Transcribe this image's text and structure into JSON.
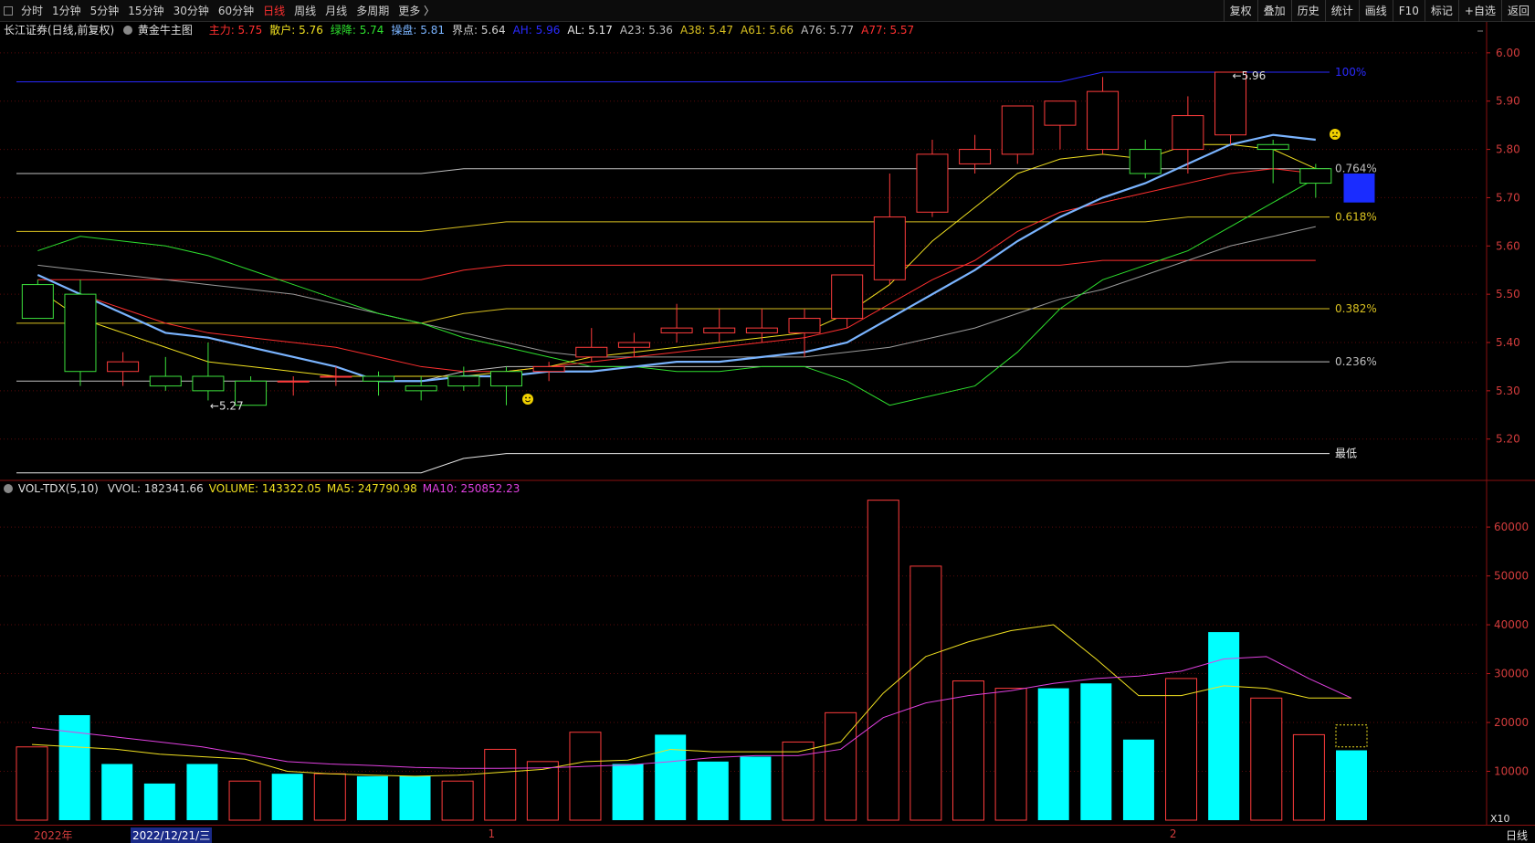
{
  "toolbar": {
    "periods": [
      "分时",
      "1分钟",
      "5分钟",
      "15分钟",
      "30分钟",
      "60分钟",
      "日线",
      "周线",
      "月线",
      "多周期",
      "更多 〉"
    ],
    "active_period": "日线",
    "right_buttons": [
      "复权",
      "叠加",
      "历史",
      "统计",
      "画线",
      "F10",
      "标记",
      "+自选",
      "返回"
    ]
  },
  "info": {
    "title": "长江证券(日线,前复权)",
    "template": "黄金牛主图",
    "items": [
      {
        "label": "主力: ",
        "value": "5.75",
        "color": "#ff2f2f"
      },
      {
        "label": "散户: ",
        "value": "5.76",
        "color": "#f0e020"
      },
      {
        "label": "绿降: ",
        "value": "5.74",
        "color": "#2ee02e"
      },
      {
        "label": "操盘: ",
        "value": "5.81",
        "color": "#7ab4ff"
      },
      {
        "label": "界点: ",
        "value": "5.64",
        "color": "#d0d0d0"
      },
      {
        "label": "AH: ",
        "value": "5.96",
        "color": "#2a2aff"
      },
      {
        "label": "AL: ",
        "value": "5.17",
        "color": "#e8e8e8"
      },
      {
        "label": "A23: ",
        "value": "5.36",
        "color": "#bfbfbf"
      },
      {
        "label": "A38: ",
        "value": "5.47",
        "color": "#d8c020"
      },
      {
        "label": "A61: ",
        "value": "5.66",
        "color": "#d8c020"
      },
      {
        "label": "A76: ",
        "value": "5.77",
        "color": "#bfbfbf"
      },
      {
        "label": "A77: ",
        "value": "5.57",
        "color": "#ff3030"
      }
    ]
  },
  "vol_info": {
    "title": "VOL-TDX(5,10)",
    "items": [
      {
        "label": "VVOL: ",
        "value": "182341.66",
        "color": "#d8d8d8"
      },
      {
        "label": "VOLUME: ",
        "value": "143322.05",
        "color": "#f0e020"
      },
      {
        "label": "MA5: ",
        "value": "247790.98",
        "color": "#f0e020"
      },
      {
        "label": "MA10: ",
        "value": "250852.23",
        "color": "#e040e0"
      }
    ]
  },
  "colors": {
    "up": "#ff3c3c",
    "down": "#3ce03c",
    "vol_down": "#00ffff",
    "bg": "#000000",
    "axis": "#c01818"
  },
  "chart_data": [
    {
      "type": "candlestick",
      "ylim": [
        5.12,
        6.03
      ],
      "y_ticks": [
        "6.00",
        "5.90",
        "5.80",
        "5.70",
        "5.60",
        "5.50",
        "5.40",
        "5.30",
        "5.20"
      ],
      "candles": [
        {
          "o": 5.52,
          "h": 5.53,
          "l": 5.45,
          "c": 5.45
        },
        {
          "o": 5.5,
          "h": 5.53,
          "l": 5.31,
          "c": 5.34
        },
        {
          "o": 5.34,
          "h": 5.38,
          "l": 5.31,
          "c": 5.36
        },
        {
          "o": 5.33,
          "h": 5.37,
          "l": 5.3,
          "c": 5.31
        },
        {
          "o": 5.33,
          "h": 5.4,
          "l": 5.28,
          "c": 5.3
        },
        {
          "o": 5.32,
          "h": 5.33,
          "l": 5.27,
          "c": 5.27
        },
        {
          "o": 5.32,
          "h": 5.33,
          "l": 5.29,
          "c": 5.32
        },
        {
          "o": 5.33,
          "h": 5.35,
          "l": 5.31,
          "c": 5.33
        },
        {
          "o": 5.33,
          "h": 5.34,
          "l": 5.29,
          "c": 5.32
        },
        {
          "o": 5.31,
          "h": 5.33,
          "l": 5.28,
          "c": 5.3
        },
        {
          "o": 5.33,
          "h": 5.35,
          "l": 5.3,
          "c": 5.31
        },
        {
          "o": 5.34,
          "h": 5.35,
          "l": 5.27,
          "c": 5.31
        },
        {
          "o": 5.34,
          "h": 5.36,
          "l": 5.32,
          "c": 5.35
        },
        {
          "o": 5.37,
          "h": 5.43,
          "l": 5.36,
          "c": 5.39
        },
        {
          "o": 5.39,
          "h": 5.42,
          "l": 5.37,
          "c": 5.4
        },
        {
          "o": 5.42,
          "h": 5.48,
          "l": 5.4,
          "c": 5.43
        },
        {
          "o": 5.42,
          "h": 5.47,
          "l": 5.4,
          "c": 5.43
        },
        {
          "o": 5.42,
          "h": 5.47,
          "l": 5.4,
          "c": 5.43
        },
        {
          "o": 5.42,
          "h": 5.47,
          "l": 5.37,
          "c": 5.45
        },
        {
          "o": 5.45,
          "h": 5.54,
          "l": 5.43,
          "c": 5.54
        },
        {
          "o": 5.53,
          "h": 5.75,
          "l": 5.52,
          "c": 5.66
        },
        {
          "o": 5.67,
          "h": 5.82,
          "l": 5.66,
          "c": 5.79
        },
        {
          "o": 5.77,
          "h": 5.83,
          "l": 5.75,
          "c": 5.8
        },
        {
          "o": 5.79,
          "h": 5.89,
          "l": 5.77,
          "c": 5.89
        },
        {
          "o": 5.85,
          "h": 5.9,
          "l": 5.8,
          "c": 5.9
        },
        {
          "o": 5.8,
          "h": 5.95,
          "l": 5.79,
          "c": 5.92
        },
        {
          "o": 5.8,
          "h": 5.82,
          "l": 5.74,
          "c": 5.75
        },
        {
          "o": 5.8,
          "h": 5.91,
          "l": 5.75,
          "c": 5.87
        },
        {
          "o": 5.83,
          "h": 5.96,
          "l": 5.81,
          "c": 5.96
        },
        {
          "o": 5.81,
          "h": 5.82,
          "l": 5.73,
          "c": 5.8
        },
        {
          "o": 5.76,
          "h": 5.77,
          "l": 5.7,
          "c": 5.73
        }
      ],
      "current_block": {
        "top": 5.75,
        "bottom": 5.69
      },
      "fib_levels": [
        {
          "label": "100%",
          "value": 5.96,
          "color": "#2a2aff"
        },
        {
          "label": "0.764%",
          "value": 5.76,
          "color": "#bfbfbf"
        },
        {
          "label": "0.618%",
          "value": 5.66,
          "color": "#d8c020"
        },
        {
          "label": "0.382%",
          "value": 5.47,
          "color": "#d8c020"
        },
        {
          "label": "0.236%",
          "value": 5.36,
          "color": "#bfbfbf"
        },
        {
          "label": "最低",
          "value": 5.17,
          "color": "#e8e8e8"
        }
      ],
      "fib_history": {
        "100%": [
          5.94,
          5.94,
          5.94,
          5.94,
          5.94,
          5.94,
          5.94,
          5.94,
          5.94,
          5.94,
          5.94,
          5.94,
          5.94,
          5.94,
          5.94,
          5.94,
          5.94,
          5.94,
          5.94,
          5.94,
          5.94,
          5.94,
          5.94,
          5.94,
          5.94,
          5.96,
          5.96,
          5.96,
          5.96,
          5.96,
          5.96
        ],
        "0.764%": [
          5.75,
          5.75,
          5.75,
          5.75,
          5.75,
          5.75,
          5.75,
          5.75,
          5.75,
          5.75,
          5.76,
          5.76,
          5.76,
          5.76,
          5.76,
          5.76,
          5.76,
          5.76,
          5.76,
          5.76,
          5.76,
          5.76,
          5.76,
          5.76,
          5.76,
          5.76,
          5.76,
          5.76,
          5.76,
          5.76,
          5.76
        ],
        "0.618%": [
          5.63,
          5.63,
          5.63,
          5.63,
          5.63,
          5.63,
          5.63,
          5.63,
          5.63,
          5.63,
          5.64,
          5.65,
          5.65,
          5.65,
          5.65,
          5.65,
          5.65,
          5.65,
          5.65,
          5.65,
          5.65,
          5.65,
          5.65,
          5.65,
          5.65,
          5.65,
          5.65,
          5.66,
          5.66,
          5.66,
          5.66
        ],
        "0.382%": [
          5.44,
          5.44,
          5.44,
          5.44,
          5.44,
          5.44,
          5.44,
          5.44,
          5.44,
          5.44,
          5.46,
          5.47,
          5.47,
          5.47,
          5.47,
          5.47,
          5.47,
          5.47,
          5.47,
          5.47,
          5.47,
          5.47,
          5.47,
          5.47,
          5.47,
          5.47,
          5.47,
          5.47,
          5.47,
          5.47,
          5.47
        ],
        "0.236%": [
          5.32,
          5.32,
          5.32,
          5.32,
          5.32,
          5.32,
          5.32,
          5.32,
          5.32,
          5.32,
          5.34,
          5.35,
          5.35,
          5.35,
          5.35,
          5.35,
          5.35,
          5.35,
          5.35,
          5.35,
          5.35,
          5.35,
          5.35,
          5.35,
          5.35,
          5.35,
          5.35,
          5.35,
          5.36,
          5.36,
          5.36
        ],
        "最低": [
          5.13,
          5.13,
          5.13,
          5.13,
          5.13,
          5.13,
          5.13,
          5.13,
          5.13,
          5.13,
          5.16,
          5.17,
          5.17,
          5.17,
          5.17,
          5.17,
          5.17,
          5.17,
          5.17,
          5.17,
          5.17,
          5.17,
          5.17,
          5.17,
          5.17,
          5.17,
          5.17,
          5.17,
          5.17,
          5.17,
          5.17
        ]
      },
      "lines": [
        {
          "color": "#ff2f2f",
          "values": [
            5.53,
            5.53,
            5.53,
            5.53,
            5.53,
            5.53,
            5.53,
            5.53,
            5.53,
            5.53,
            5.55,
            5.56,
            5.56,
            5.56,
            5.56,
            5.56,
            5.56,
            5.56,
            5.56,
            5.56,
            5.56,
            5.56,
            5.56,
            5.56,
            5.56,
            5.57,
            5.57,
            5.57,
            5.57,
            5.57,
            5.57
          ]
        },
        {
          "color": "#9a9a9a",
          "values": [
            5.56,
            5.55,
            5.54,
            5.53,
            5.52,
            5.51,
            5.5,
            5.48,
            5.46,
            5.44,
            5.42,
            5.4,
            5.38,
            5.37,
            5.37,
            5.37,
            5.37,
            5.37,
            5.37,
            5.38,
            5.39,
            5.41,
            5.43,
            5.46,
            5.49,
            5.51,
            5.54,
            5.57,
            5.6,
            5.62,
            5.64
          ]
        },
        {
          "color": "#2ee02e",
          "values": [
            5.59,
            5.62,
            5.61,
            5.6,
            5.58,
            5.55,
            5.52,
            5.49,
            5.46,
            5.44,
            5.41,
            5.39,
            5.37,
            5.35,
            5.35,
            5.34,
            5.34,
            5.35,
            5.35,
            5.32,
            5.27,
            5.29,
            5.31,
            5.38,
            5.47,
            5.53,
            5.56,
            5.59,
            5.64,
            5.69,
            5.74
          ]
        },
        {
          "color": "#ff2f2f",
          "values": [
            5.54,
            5.5,
            5.47,
            5.44,
            5.42,
            5.41,
            5.4,
            5.39,
            5.37,
            5.35,
            5.34,
            5.34,
            5.35,
            5.36,
            5.37,
            5.38,
            5.39,
            5.4,
            5.41,
            5.43,
            5.48,
            5.53,
            5.57,
            5.63,
            5.67,
            5.69,
            5.71,
            5.73,
            5.75,
            5.76,
            5.75
          ]
        },
        {
          "color": "#f0e020",
          "values": [
            5.51,
            5.45,
            5.42,
            5.39,
            5.36,
            5.35,
            5.34,
            5.33,
            5.33,
            5.33,
            5.33,
            5.34,
            5.35,
            5.37,
            5.38,
            5.39,
            5.4,
            5.41,
            5.42,
            5.46,
            5.52,
            5.61,
            5.68,
            5.75,
            5.78,
            5.79,
            5.78,
            5.81,
            5.81,
            5.8,
            5.76
          ]
        },
        {
          "color": "#7ab4ff",
          "width": 2.2,
          "values": [
            5.54,
            5.5,
            5.46,
            5.42,
            5.41,
            5.39,
            5.37,
            5.35,
            5.32,
            5.32,
            5.33,
            5.33,
            5.34,
            5.34,
            5.35,
            5.36,
            5.36,
            5.37,
            5.38,
            5.4,
            5.45,
            5.5,
            5.55,
            5.61,
            5.66,
            5.7,
            5.73,
            5.77,
            5.81,
            5.83,
            5.82
          ]
        }
      ],
      "annotations": [
        {
          "text": "←5.27",
          "color": "#e0e0e0"
        },
        {
          "text": "←5.96",
          "color": "#e0e0e0"
        }
      ]
    },
    {
      "type": "bar",
      "ylim": [
        0,
        66000
      ],
      "y_ticks": [
        "60000",
        "50000",
        "40000",
        "30000",
        "20000",
        "10000"
      ],
      "scale_label": "X10",
      "values": [
        15000,
        21500,
        11500,
        7500,
        11500,
        8000,
        9500,
        9500,
        9000,
        9000,
        8000,
        14500,
        12000,
        18000,
        11500,
        17500,
        12000,
        13000,
        16000,
        22000,
        65500,
        52000,
        28500,
        27000,
        27000,
        28000,
        16500,
        29000,
        38500,
        25000,
        17500,
        14300
      ],
      "kinds": [
        "u",
        "d",
        "d",
        "d",
        "d",
        "u",
        "d",
        "u",
        "d",
        "d",
        "u",
        "u",
        "u",
        "u",
        "d",
        "d",
        "d",
        "d",
        "u",
        "u",
        "u",
        "u",
        "u",
        "u",
        "d",
        "d",
        "d",
        "u",
        "d",
        "u",
        "u",
        "d"
      ],
      "ma5": [
        15500,
        15000,
        14500,
        13500,
        13000,
        12500,
        10000,
        9500,
        9200,
        9000,
        9200,
        9800,
        10400,
        12000,
        12300,
        14500,
        14000,
        14000,
        14000,
        16000,
        26000,
        33500,
        36500,
        38800,
        40000,
        33000,
        25500,
        25500,
        27500,
        27000,
        25000,
        25000
      ],
      "ma10": [
        19000,
        18000,
        17000,
        16000,
        15000,
        13500,
        12000,
        11500,
        11200,
        10800,
        10600,
        10600,
        10700,
        11000,
        11300,
        12000,
        12800,
        13200,
        13200,
        14500,
        21000,
        24000,
        25500,
        26500,
        28000,
        29000,
        29500,
        30500,
        33000,
        33500,
        29000,
        25000
      ],
      "x_labels": [
        {
          "text": "2022年",
          "pos": 0.022
        },
        {
          "text": "1",
          "pos": 0.318
        },
        {
          "text": "2",
          "pos": 0.762
        }
      ],
      "selected_date": "2022/12/21/三"
    }
  ]
}
